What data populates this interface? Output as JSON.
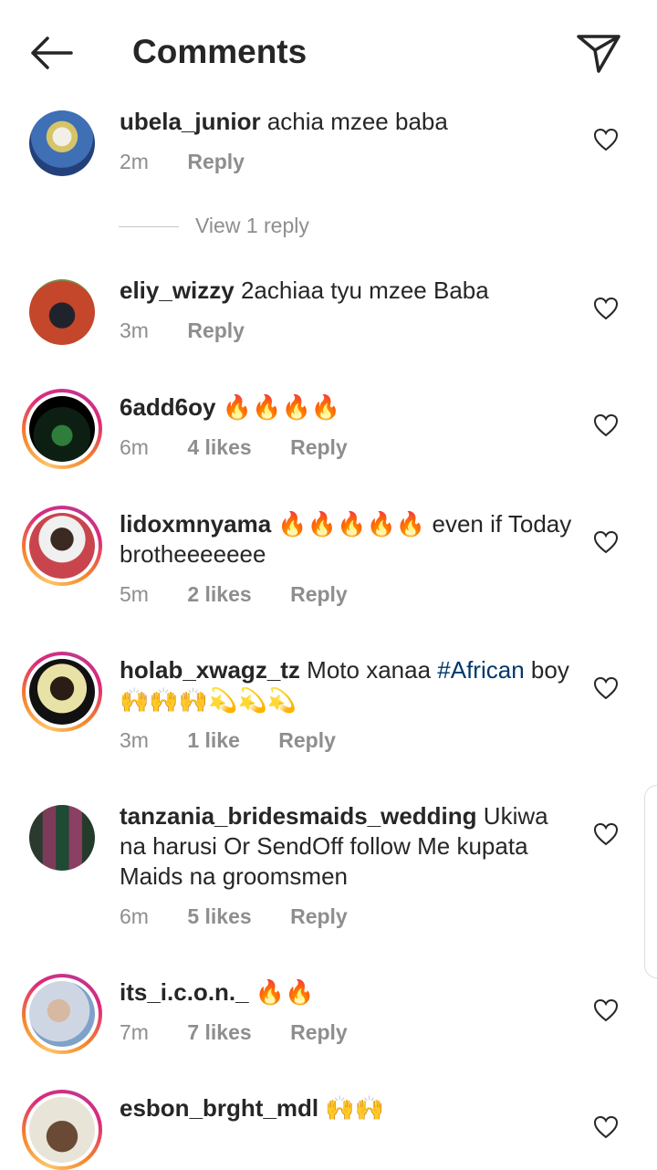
{
  "header": {
    "title": "Comments",
    "back_icon": "arrow-left-icon",
    "send_icon": "send-icon"
  },
  "reply_label": "Reply",
  "view_replies": "View 1 reply",
  "comments": [
    {
      "username": "ubela_junior",
      "text": "achia mzee baba",
      "time": "2m",
      "likes": "",
      "ring": false
    },
    {
      "username": "eliy_wizzy",
      "text": "2achiaa tyu mzee Baba",
      "time": "3m",
      "likes": "",
      "ring": false
    },
    {
      "username": "6add6oy",
      "text": "🔥🔥🔥🔥",
      "time": "6m",
      "likes": "4 likes",
      "ring": true
    },
    {
      "username": "lidoxmnyama",
      "text": "🔥🔥🔥🔥🔥 even if Today brotheeeeeee",
      "time": "5m",
      "likes": "2 likes",
      "ring": true
    },
    {
      "username": "holab_xwagz_tz",
      "text": "Moto xanaa",
      "hashtag": "#African",
      "text_after": "boy🙌🙌🙌💫💫💫",
      "time": "3m",
      "likes": "1 like",
      "ring": true
    },
    {
      "username": "tanzania_bridesmaids_wedding",
      "text": "Ukiwa na harusi Or SendOff follow Me kupata Maids na groomsmen",
      "time": "6m",
      "likes": "5 likes",
      "ring": false
    },
    {
      "username": "its_i.c.o.n._",
      "text": "🔥🔥",
      "time": "7m",
      "likes": "7 likes",
      "ring": true
    },
    {
      "username": "esbon_brght_mdl",
      "text": "🙌🙌",
      "time": "",
      "likes": "",
      "ring": true
    }
  ],
  "colors": {
    "text": "#262626",
    "meta": "#8e8e8e",
    "hashtag": "#00376b"
  }
}
